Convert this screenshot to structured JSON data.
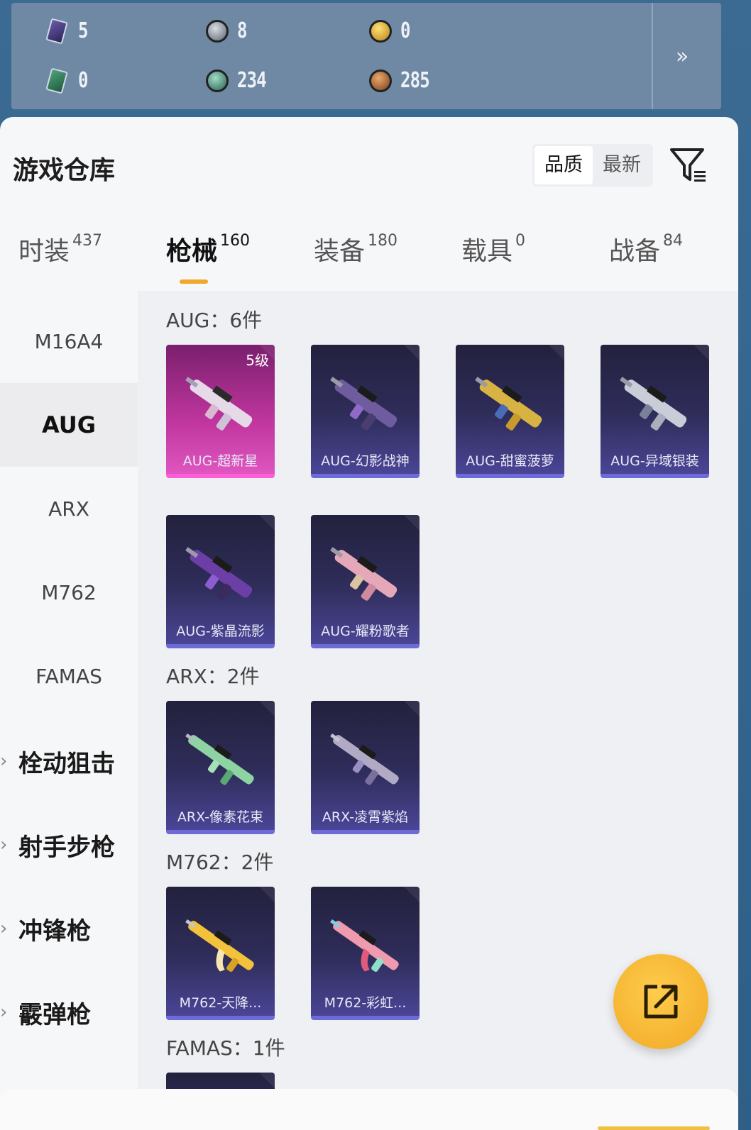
{
  "currency": {
    "row1": [
      {
        "icon": "purple-card-icon",
        "value": "5"
      },
      {
        "icon": "silver-coin-icon",
        "value": "8"
      },
      {
        "icon": "gold-coin-icon",
        "value": "0"
      }
    ],
    "row2": [
      {
        "icon": "green-card-icon",
        "value": "0"
      },
      {
        "icon": "teal-coin-icon",
        "value": "234"
      },
      {
        "icon": "bronze-coin-icon",
        "value": "285"
      }
    ],
    "more_label": "»"
  },
  "header": {
    "title": "游戏仓库",
    "sort": {
      "quality": "品质",
      "newest": "最新",
      "active": "品质"
    }
  },
  "tabs": [
    {
      "label": "时装",
      "count": "437"
    },
    {
      "label": "枪械",
      "count": "160",
      "active": true
    },
    {
      "label": "装备",
      "count": "180"
    },
    {
      "label": "载具",
      "count": "0"
    },
    {
      "label": "战备",
      "count": "84"
    }
  ],
  "sidebar": {
    "items": [
      "M16A4",
      "AUG",
      "ARX",
      "M762",
      "FAMAS"
    ],
    "active": "AUG",
    "groups": [
      "栓动狙击",
      "射手步枪",
      "冲锋枪",
      "霰弹枪"
    ]
  },
  "sections": [
    {
      "title": "AUG：6件",
      "items": [
        {
          "name": "AUG-超新星",
          "level": "5级",
          "rarity": "pink"
        },
        {
          "name": "AUG-幻影战神"
        },
        {
          "name": "AUG-甜蜜菠萝"
        },
        {
          "name": "AUG-异域银装"
        },
        {
          "name": "AUG-紫晶流影"
        },
        {
          "name": "AUG-耀粉歌者"
        }
      ]
    },
    {
      "title": "ARX：2件",
      "items": [
        {
          "name": "ARX-像素花束"
        },
        {
          "name": "ARX-凌霄紫焰"
        }
      ]
    },
    {
      "title": "M762：2件",
      "items": [
        {
          "name": "M762-天降..."
        },
        {
          "name": "M762-彩虹..."
        }
      ]
    },
    {
      "title": "FAMAS：1件",
      "items": []
    }
  ],
  "colors": {
    "accent": "#f0a92b",
    "card_bg": "#2f2d5a",
    "card_pink": "#c0369e",
    "fab": "#f5b52e"
  }
}
